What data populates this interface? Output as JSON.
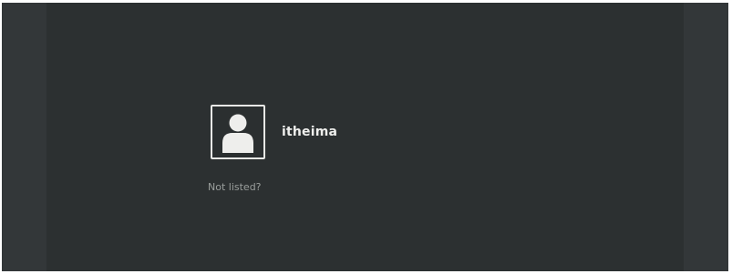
{
  "login": {
    "users": [
      {
        "name": "itheima",
        "avatar_icon": "user-silhouette-icon"
      }
    ],
    "not_listed_label": "Not listed?"
  },
  "colors": {
    "background": "#2c3031",
    "side_panels": "#333739",
    "avatar_border": "#e8e8e6",
    "username_text": "#eeeeec",
    "link_text": "#9a9e9c"
  }
}
